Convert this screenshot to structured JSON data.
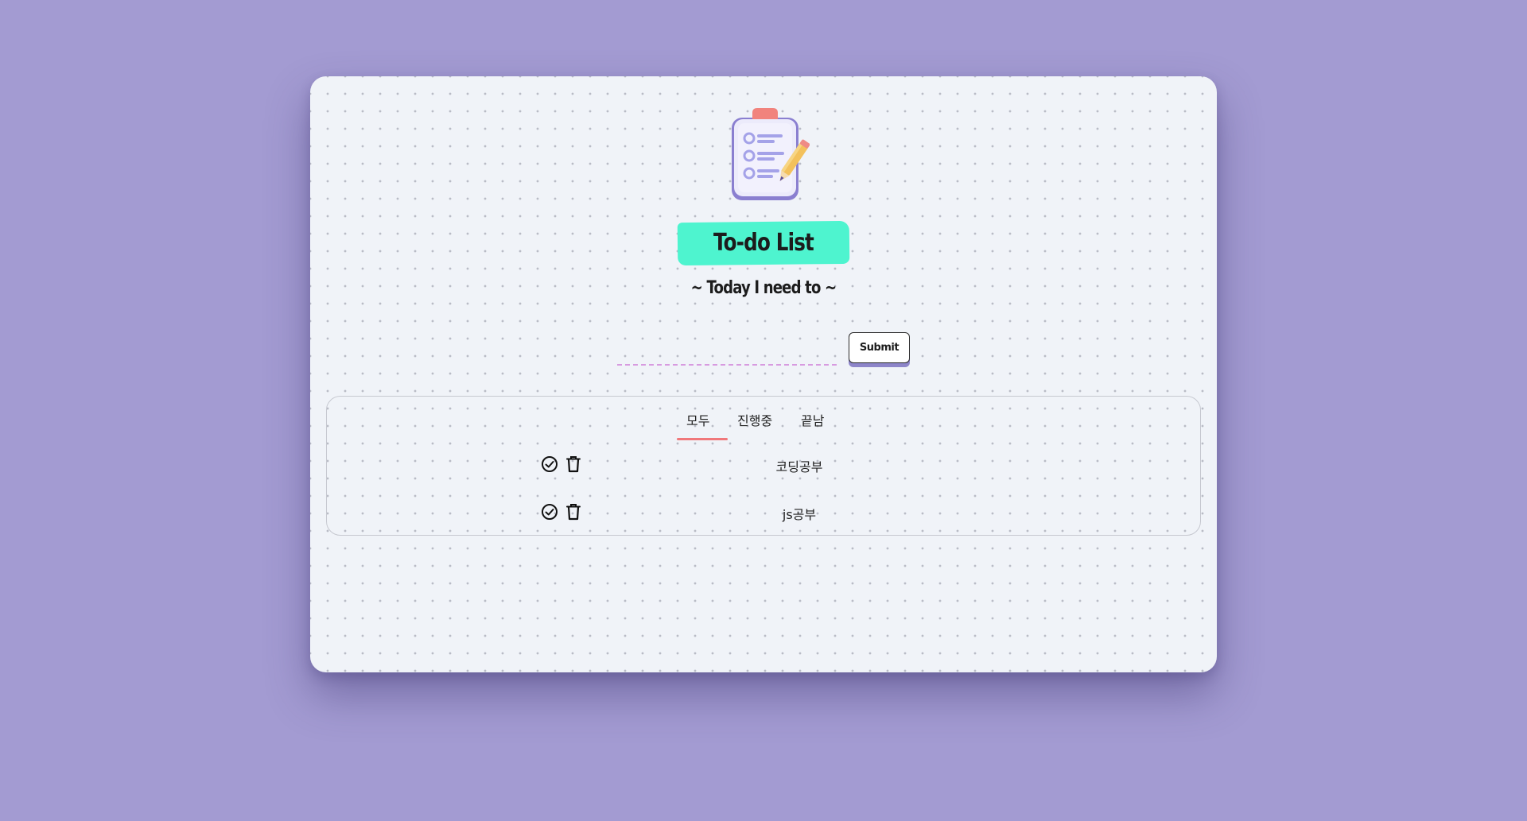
{
  "app": {
    "title": "To-do List",
    "subtitle": "~ Today I need to ~"
  },
  "input": {
    "value": "",
    "placeholder": ""
  },
  "submit_label": "Submit",
  "tabs": [
    {
      "label": "모두",
      "active": true
    },
    {
      "label": "진행중",
      "active": false
    },
    {
      "label": "끝남",
      "active": false
    }
  ],
  "tasks": [
    {
      "text": "코딩공부"
    },
    {
      "text": "js공부"
    }
  ],
  "icons": {
    "logo": "clipboard-checklist-pencil-icon",
    "complete": "check-circle-icon",
    "delete": "trash-icon"
  },
  "colors": {
    "background": "#a39bd2",
    "card": "#f0f3f8",
    "title_highlight": "#4ef4cf",
    "tab_underline": "#f0787b",
    "input_underline": "#d79be0",
    "button_shadow": "#8d85c9"
  }
}
